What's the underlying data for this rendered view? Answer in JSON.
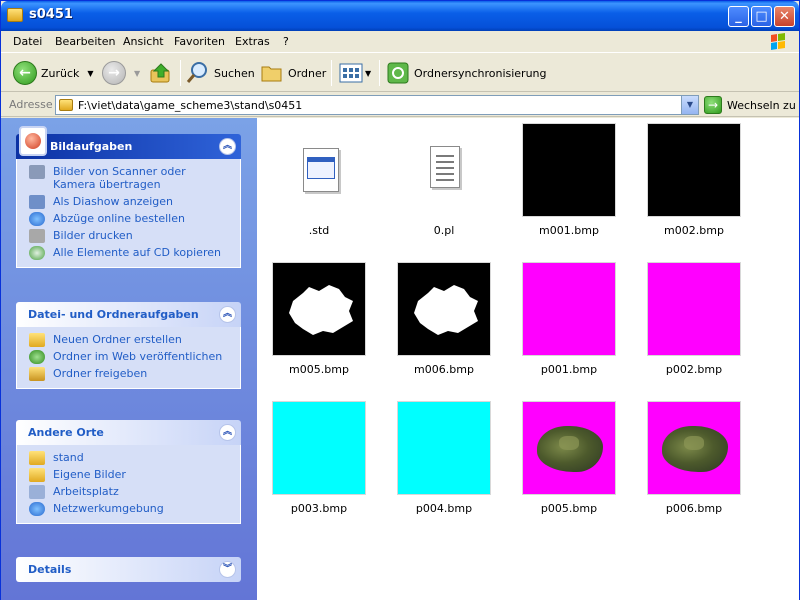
{
  "window": {
    "title": "s0451"
  },
  "menu": [
    "Datei",
    "Bearbeiten",
    "Ansicht",
    "Favoriten",
    "Extras",
    "?"
  ],
  "toolbar": {
    "back_label": "Zurück",
    "search_label": "Suchen",
    "folders_label": "Ordner",
    "sync_label": "Ordnersynchronisierung"
  },
  "address": {
    "label": "Adresse",
    "path": "F:\\viet\\data\\game_scheme3\\stand\\s0451",
    "go_label": "Wechseln zu"
  },
  "panels": {
    "picture_tasks": {
      "title": "Bildaufgaben",
      "items": [
        "Bilder von Scanner oder Kamera übertragen",
        "Als Diashow anzeigen",
        "Abzüge online bestellen",
        "Bilder drucken",
        "Alle Elemente auf CD kopieren"
      ]
    },
    "file_tasks": {
      "title": "Datei- und Ordneraufgaben",
      "items": [
        "Neuen Ordner erstellen",
        "Ordner im Web veröffentlichen",
        "Ordner freigeben"
      ]
    },
    "other_places": {
      "title": "Andere Orte",
      "items": [
        "stand",
        "Eigene Bilder",
        "Arbeitsplatz",
        "Netzwerkumgebung"
      ]
    },
    "details": {
      "title": "Details"
    }
  },
  "files": [
    {
      "name": ".std",
      "kind": "std-icon"
    },
    {
      "name": "0.pl",
      "kind": "notepad-icon"
    },
    {
      "name": "m001.bmp",
      "kind": "thumb",
      "color": "#000000"
    },
    {
      "name": "m002.bmp",
      "kind": "thumb",
      "color": "#000000"
    },
    {
      "name": "m005.bmp",
      "kind": "mask",
      "color": "#000000"
    },
    {
      "name": "m006.bmp",
      "kind": "mask",
      "color": "#000000"
    },
    {
      "name": "p001.bmp",
      "kind": "thumb",
      "color": "#ff00ff"
    },
    {
      "name": "p002.bmp",
      "kind": "thumb",
      "color": "#ff00ff"
    },
    {
      "name": "p003.bmp",
      "kind": "thumb",
      "color": "#00ffff"
    },
    {
      "name": "p004.bmp",
      "kind": "thumb",
      "color": "#00ffff"
    },
    {
      "name": "p005.bmp",
      "kind": "terrain",
      "color": "#ff00ff"
    },
    {
      "name": "p006.bmp",
      "kind": "terrain",
      "color": "#ff00ff"
    }
  ],
  "colors": {
    "accent": "#0054e3",
    "task_link": "#215dc6",
    "panel_body": "#d6dff7"
  }
}
